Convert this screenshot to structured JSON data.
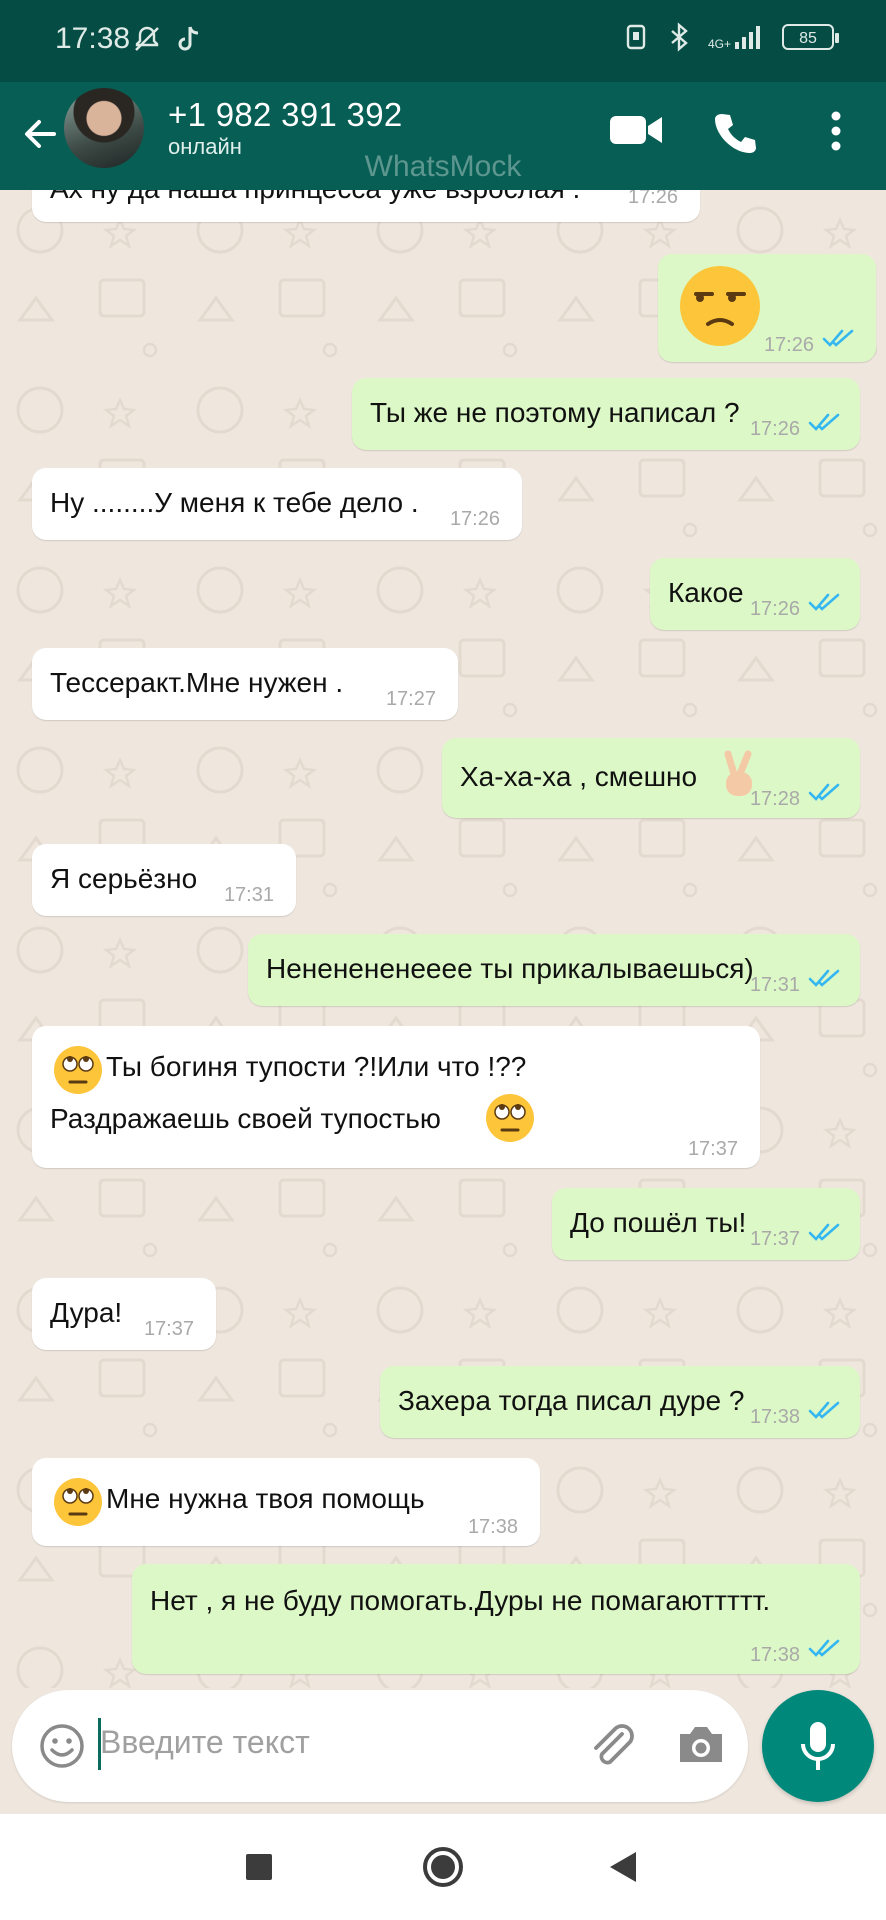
{
  "status_bar": {
    "time": "17:38",
    "network": "4G+",
    "battery": "85"
  },
  "header": {
    "contact_name": "+1 982 391 392",
    "contact_status": "онлайн",
    "watermark": "WhatsMock"
  },
  "messages": [
    {
      "dir": "in",
      "text": "Ах ну да наша принцесса уже взрослая .",
      "time": "17:26"
    },
    {
      "dir": "out",
      "text": "",
      "emoji": "unamused-face",
      "time": "17:26"
    },
    {
      "dir": "out",
      "text": "Ты же не поэтому написал ?",
      "time": "17:26"
    },
    {
      "dir": "in",
      "text": "Ну ........У меня к тебе дело .",
      "time": "17:26"
    },
    {
      "dir": "out",
      "text": "Какое",
      "time": "17:26"
    },
    {
      "dir": "in",
      "text": "Тессеракт.Мне нужен .",
      "time": "17:27"
    },
    {
      "dir": "out",
      "text": "Ха-ха-ха , смешно",
      "emoji": "victory-hand",
      "time": "17:28"
    },
    {
      "dir": "in",
      "text": "Я серьёзно",
      "time": "17:31"
    },
    {
      "dir": "out",
      "text": "Нененененееее ты прикалываешься)",
      "time": "17:31"
    },
    {
      "dir": "in",
      "text": "Ты богиня тупости ?!Или что !??",
      "text2": "Раздражаешь своей тупостью",
      "emoji": "eye-roll-face",
      "time": "17:37"
    },
    {
      "dir": "out",
      "text": "До пошёл ты!",
      "time": "17:37"
    },
    {
      "dir": "in",
      "text": "Дура!",
      "time": "17:37"
    },
    {
      "dir": "out",
      "text": "Захера тогда писал дуре ?",
      "time": "17:38"
    },
    {
      "dir": "in",
      "text": "Мне нужна твоя помощь",
      "emoji": "eye-roll-face",
      "time": "17:38"
    },
    {
      "dir": "out",
      "text": "Нет , я не буду помогать.Дуры не помагаюттттт.",
      "time": "17:38"
    }
  ],
  "composer": {
    "placeholder": "Введите текст"
  },
  "colors": {
    "header": "#075e54",
    "status_bar": "#054d44",
    "outgoing": "#dcf8c6",
    "incoming": "#ffffff",
    "ticks": "#34b7f1",
    "mic": "#00897b"
  }
}
